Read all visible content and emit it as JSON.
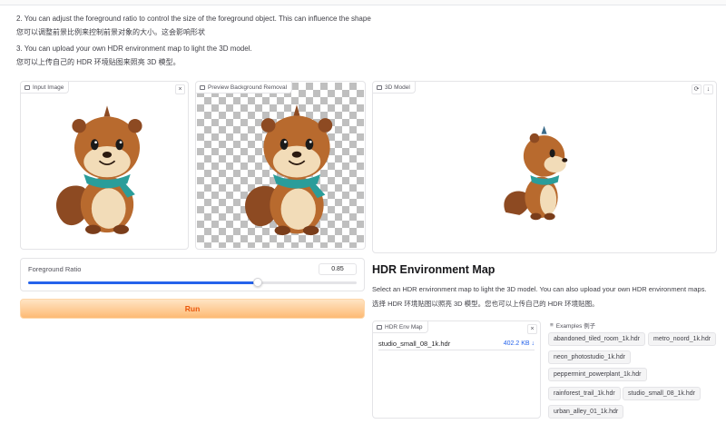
{
  "instructions": {
    "step2_en": "2. You can adjust the foreground ratio to control the size of the foreground object. This can influence the shape",
    "step2_zh": "您可以调整前景比例来控制前景对象的大小。这会影响形状",
    "step3_en": "3. You can upload your own HDR environment map to light the 3D model.",
    "step3_zh": "您可以上传自己的 HDR 环境贴图来照亮 3D 模型。"
  },
  "panels": {
    "input_image": {
      "label": "Input Image",
      "close_icon": "×"
    },
    "preview": {
      "label": "Preview Background Removal"
    },
    "model3d": {
      "label": "3D Model",
      "reset_icon": "⟳",
      "download_icon": "↓"
    }
  },
  "slider": {
    "label": "Foreground Ratio",
    "value": "0.85",
    "min": 0.5,
    "max": 1.0,
    "current": 0.85
  },
  "run_button": {
    "label": "Run"
  },
  "hdr": {
    "title": "HDR Environment Map",
    "desc_en": "Select an HDR environment map to light the 3D model. You can also upload your own HDR environment maps.",
    "desc_zh": "选择 HDR 环境贴图以照亮 3D 模型。您也可以上传自己的 HDR 环境贴图。",
    "file_panel_label": "HDR Env Map",
    "file_name": "studio_small_08_1k.hdr",
    "file_size": "402.2 KB ↓"
  },
  "examples": {
    "label": "Examples 例子",
    "items": [
      "abandoned_tiled_room_1k.hdr",
      "metro_noord_1k.hdr",
      "neon_photostudio_1k.hdr",
      "peppermint_powerplant_1k.hdr",
      "rainforest_trail_1k.hdr",
      "studio_small_08_1k.hdr",
      "urban_alley_01_1k.hdr"
    ]
  },
  "colors": {
    "accent": "#2563eb",
    "run_text": "#ea580c",
    "run_bg": "#fdba74"
  }
}
